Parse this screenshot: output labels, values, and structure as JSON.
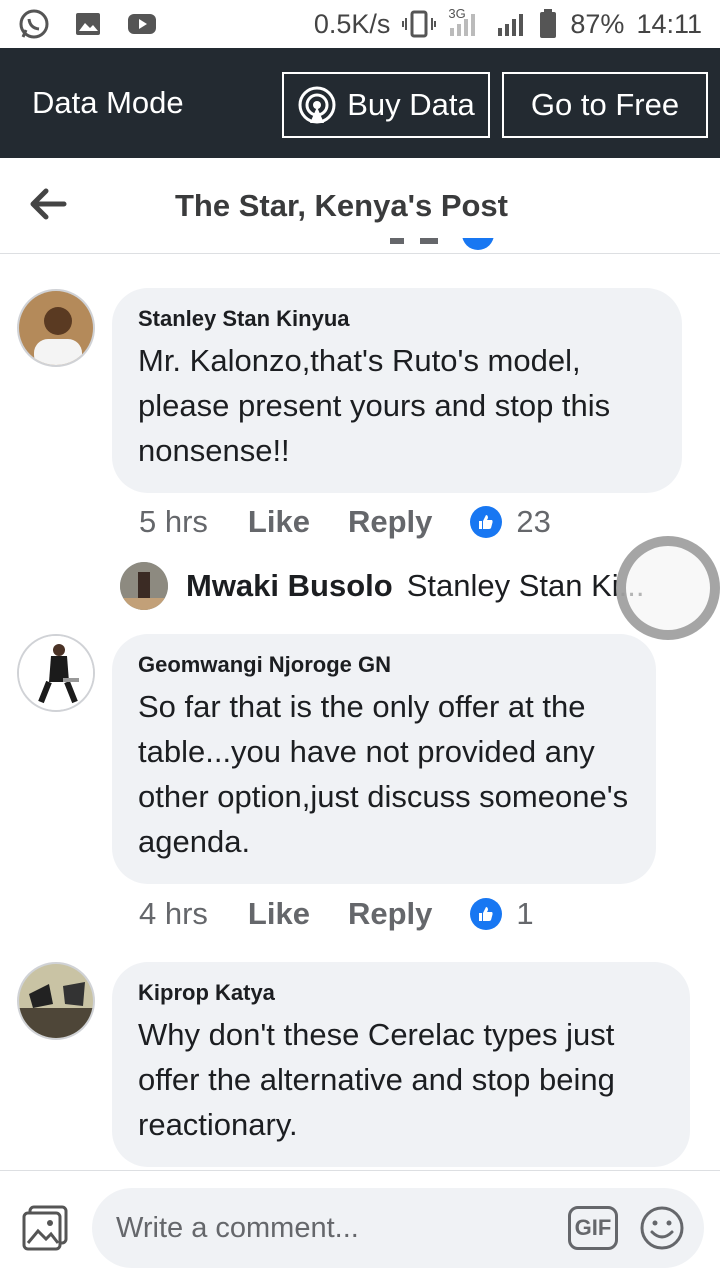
{
  "status_bar": {
    "left_icons": [
      "whatsapp-icon",
      "gallery-icon",
      "youtube-icon"
    ],
    "speed": "0.5K/s",
    "network": "3G",
    "battery": "87%",
    "time": "14:11"
  },
  "data_bar": {
    "title": "Data Mode",
    "buy_label": "Buy Data",
    "free_label": "Go to Free"
  },
  "header": {
    "title": "The Star, Kenya's Post"
  },
  "comments": [
    {
      "author": "Stanley Stan Kinyua",
      "text": "Mr. Kalonzo,that's Ruto's model, please present yours and stop this nonsense!!",
      "time": "5 hrs",
      "like_label": "Like",
      "reply_label": "Reply",
      "reactions": "23"
    },
    {
      "author": "Geomwangi Njoroge GN",
      "text": "So far that is the only offer at the table...you have not provided any other option,just discuss someone's agenda.",
      "time": "4 hrs",
      "like_label": "Like",
      "reply_label": "Reply",
      "reactions": "1"
    },
    {
      "author": "Kiprop Katya",
      "text": "Why don't these Cerelac types just offer the alternative and stop being reactionary."
    }
  ],
  "reply_preview": {
    "name": "Mwaki Busolo",
    "snippet": "Stanley Stan Ki..."
  },
  "composer": {
    "placeholder": "Write a comment...",
    "gif_label": "GIF"
  },
  "colors": {
    "data_bar_bg": "#232a31",
    "bubble_bg": "#f0f2f5",
    "like_blue": "#1877f2"
  }
}
